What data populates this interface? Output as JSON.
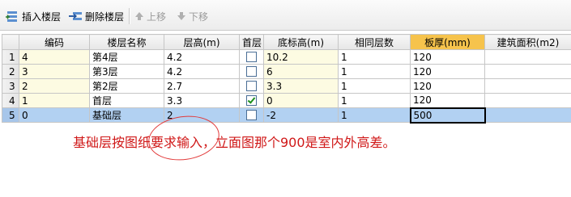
{
  "toolbar": {
    "insert": "插入楼层",
    "delete": "删除楼层",
    "up": "上移",
    "down": "下移"
  },
  "columns": [
    "",
    "编码",
    "楼层名称",
    "层高(m)",
    "首层",
    "底标高(m)",
    "相同层数",
    "板厚(mm)",
    "建筑面积(m2)"
  ],
  "rows": [
    {
      "num": "1",
      "code": "4",
      "name": "第4层",
      "height": "4.2",
      "first": false,
      "base": "10.2",
      "same": "1",
      "thick": "120",
      "area": ""
    },
    {
      "num": "2",
      "code": "3",
      "name": "第3层",
      "height": "4.2",
      "first": false,
      "base": "6",
      "same": "1",
      "thick": "120",
      "area": ""
    },
    {
      "num": "3",
      "code": "2",
      "name": "第2层",
      "height": "2.7",
      "first": false,
      "base": "3.3",
      "same": "1",
      "thick": "120",
      "area": ""
    },
    {
      "num": "4",
      "code": "1",
      "name": "首层",
      "height": "3.3",
      "first": true,
      "base": "0",
      "same": "1",
      "thick": "120",
      "area": ""
    },
    {
      "num": "5",
      "code": "0",
      "name": "基础层",
      "height": "2",
      "first": false,
      "base": "-2",
      "same": "1",
      "thick": "500",
      "area": ""
    }
  ],
  "annotation": "基础层按图纸要求输入，立面图那个900是室内外高差。"
}
